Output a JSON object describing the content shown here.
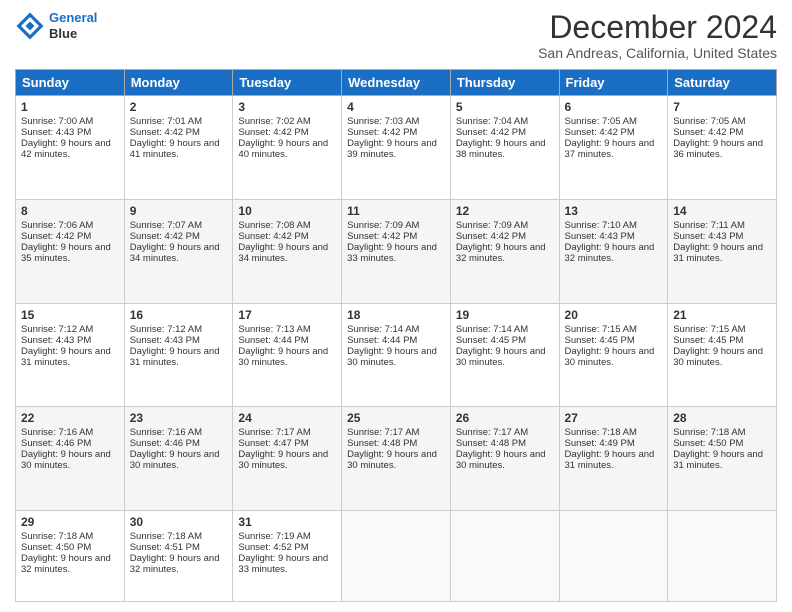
{
  "header": {
    "logo_line1": "General",
    "logo_line2": "Blue",
    "title": "December 2024",
    "subtitle": "San Andreas, California, United States"
  },
  "columns": [
    "Sunday",
    "Monday",
    "Tuesday",
    "Wednesday",
    "Thursday",
    "Friday",
    "Saturday"
  ],
  "weeks": [
    [
      {
        "day": "1",
        "sunrise": "Sunrise: 7:00 AM",
        "sunset": "Sunset: 4:43 PM",
        "daylight": "Daylight: 9 hours and 42 minutes."
      },
      {
        "day": "2",
        "sunrise": "Sunrise: 7:01 AM",
        "sunset": "Sunset: 4:42 PM",
        "daylight": "Daylight: 9 hours and 41 minutes."
      },
      {
        "day": "3",
        "sunrise": "Sunrise: 7:02 AM",
        "sunset": "Sunset: 4:42 PM",
        "daylight": "Daylight: 9 hours and 40 minutes."
      },
      {
        "day": "4",
        "sunrise": "Sunrise: 7:03 AM",
        "sunset": "Sunset: 4:42 PM",
        "daylight": "Daylight: 9 hours and 39 minutes."
      },
      {
        "day": "5",
        "sunrise": "Sunrise: 7:04 AM",
        "sunset": "Sunset: 4:42 PM",
        "daylight": "Daylight: 9 hours and 38 minutes."
      },
      {
        "day": "6",
        "sunrise": "Sunrise: 7:05 AM",
        "sunset": "Sunset: 4:42 PM",
        "daylight": "Daylight: 9 hours and 37 minutes."
      },
      {
        "day": "7",
        "sunrise": "Sunrise: 7:05 AM",
        "sunset": "Sunset: 4:42 PM",
        "daylight": "Daylight: 9 hours and 36 minutes."
      }
    ],
    [
      {
        "day": "8",
        "sunrise": "Sunrise: 7:06 AM",
        "sunset": "Sunset: 4:42 PM",
        "daylight": "Daylight: 9 hours and 35 minutes."
      },
      {
        "day": "9",
        "sunrise": "Sunrise: 7:07 AM",
        "sunset": "Sunset: 4:42 PM",
        "daylight": "Daylight: 9 hours and 34 minutes."
      },
      {
        "day": "10",
        "sunrise": "Sunrise: 7:08 AM",
        "sunset": "Sunset: 4:42 PM",
        "daylight": "Daylight: 9 hours and 34 minutes."
      },
      {
        "day": "11",
        "sunrise": "Sunrise: 7:09 AM",
        "sunset": "Sunset: 4:42 PM",
        "daylight": "Daylight: 9 hours and 33 minutes."
      },
      {
        "day": "12",
        "sunrise": "Sunrise: 7:09 AM",
        "sunset": "Sunset: 4:42 PM",
        "daylight": "Daylight: 9 hours and 32 minutes."
      },
      {
        "day": "13",
        "sunrise": "Sunrise: 7:10 AM",
        "sunset": "Sunset: 4:43 PM",
        "daylight": "Daylight: 9 hours and 32 minutes."
      },
      {
        "day": "14",
        "sunrise": "Sunrise: 7:11 AM",
        "sunset": "Sunset: 4:43 PM",
        "daylight": "Daylight: 9 hours and 31 minutes."
      }
    ],
    [
      {
        "day": "15",
        "sunrise": "Sunrise: 7:12 AM",
        "sunset": "Sunset: 4:43 PM",
        "daylight": "Daylight: 9 hours and 31 minutes."
      },
      {
        "day": "16",
        "sunrise": "Sunrise: 7:12 AM",
        "sunset": "Sunset: 4:43 PM",
        "daylight": "Daylight: 9 hours and 31 minutes."
      },
      {
        "day": "17",
        "sunrise": "Sunrise: 7:13 AM",
        "sunset": "Sunset: 4:44 PM",
        "daylight": "Daylight: 9 hours and 30 minutes."
      },
      {
        "day": "18",
        "sunrise": "Sunrise: 7:14 AM",
        "sunset": "Sunset: 4:44 PM",
        "daylight": "Daylight: 9 hours and 30 minutes."
      },
      {
        "day": "19",
        "sunrise": "Sunrise: 7:14 AM",
        "sunset": "Sunset: 4:45 PM",
        "daylight": "Daylight: 9 hours and 30 minutes."
      },
      {
        "day": "20",
        "sunrise": "Sunrise: 7:15 AM",
        "sunset": "Sunset: 4:45 PM",
        "daylight": "Daylight: 9 hours and 30 minutes."
      },
      {
        "day": "21",
        "sunrise": "Sunrise: 7:15 AM",
        "sunset": "Sunset: 4:45 PM",
        "daylight": "Daylight: 9 hours and 30 minutes."
      }
    ],
    [
      {
        "day": "22",
        "sunrise": "Sunrise: 7:16 AM",
        "sunset": "Sunset: 4:46 PM",
        "daylight": "Daylight: 9 hours and 30 minutes."
      },
      {
        "day": "23",
        "sunrise": "Sunrise: 7:16 AM",
        "sunset": "Sunset: 4:46 PM",
        "daylight": "Daylight: 9 hours and 30 minutes."
      },
      {
        "day": "24",
        "sunrise": "Sunrise: 7:17 AM",
        "sunset": "Sunset: 4:47 PM",
        "daylight": "Daylight: 9 hours and 30 minutes."
      },
      {
        "day": "25",
        "sunrise": "Sunrise: 7:17 AM",
        "sunset": "Sunset: 4:48 PM",
        "daylight": "Daylight: 9 hours and 30 minutes."
      },
      {
        "day": "26",
        "sunrise": "Sunrise: 7:17 AM",
        "sunset": "Sunset: 4:48 PM",
        "daylight": "Daylight: 9 hours and 30 minutes."
      },
      {
        "day": "27",
        "sunrise": "Sunrise: 7:18 AM",
        "sunset": "Sunset: 4:49 PM",
        "daylight": "Daylight: 9 hours and 31 minutes."
      },
      {
        "day": "28",
        "sunrise": "Sunrise: 7:18 AM",
        "sunset": "Sunset: 4:50 PM",
        "daylight": "Daylight: 9 hours and 31 minutes."
      }
    ],
    [
      {
        "day": "29",
        "sunrise": "Sunrise: 7:18 AM",
        "sunset": "Sunset: 4:50 PM",
        "daylight": "Daylight: 9 hours and 32 minutes."
      },
      {
        "day": "30",
        "sunrise": "Sunrise: 7:18 AM",
        "sunset": "Sunset: 4:51 PM",
        "daylight": "Daylight: 9 hours and 32 minutes."
      },
      {
        "day": "31",
        "sunrise": "Sunrise: 7:19 AM",
        "sunset": "Sunset: 4:52 PM",
        "daylight": "Daylight: 9 hours and 33 minutes."
      },
      null,
      null,
      null,
      null
    ]
  ]
}
